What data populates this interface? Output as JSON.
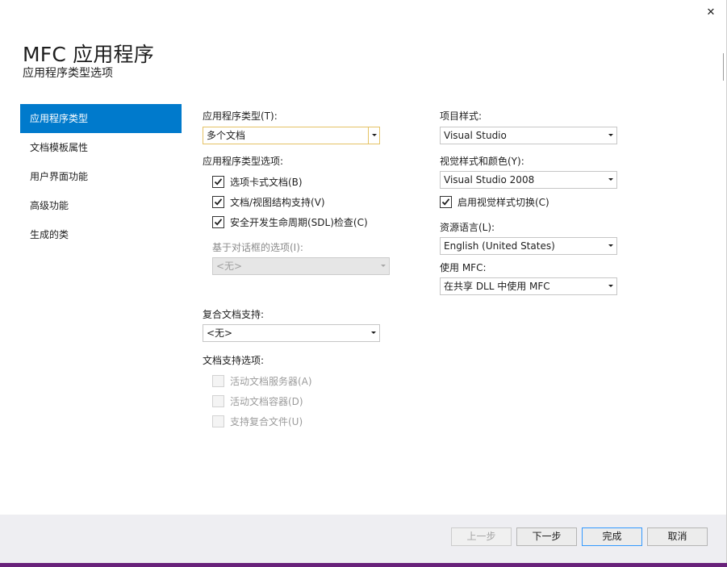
{
  "window": {
    "close_glyph": "✕"
  },
  "header": {
    "title": "MFC 应用程序",
    "subtitle": "应用程序类型选项"
  },
  "sidebar": {
    "items": [
      {
        "label": "应用程序类型",
        "active": true
      },
      {
        "label": "文档模板属性",
        "active": false
      },
      {
        "label": "用户界面功能",
        "active": false
      },
      {
        "label": "高级功能",
        "active": false
      },
      {
        "label": "生成的类",
        "active": false
      }
    ]
  },
  "left": {
    "app_type": {
      "label": "应用程序类型(T):",
      "value": "多个文档"
    },
    "app_type_options": {
      "label": "应用程序类型选项:",
      "checks": [
        {
          "label": "选项卡式文档(B)",
          "checked": true
        },
        {
          "label": "文档/视图结构支持(V)",
          "checked": true
        },
        {
          "label": "安全开发生命周期(SDL)检查(C)",
          "checked": true
        }
      ]
    },
    "dialog_options": {
      "label": "基于对话框的选项(I):",
      "value": "<无>"
    },
    "compound_doc": {
      "label": "复合文档支持:",
      "value": "<无>"
    },
    "doc_support": {
      "label": "文档支持选项:",
      "checks": [
        {
          "label": "活动文档服务器(A)",
          "checked": false
        },
        {
          "label": "活动文档容器(D)",
          "checked": false
        },
        {
          "label": "支持复合文件(U)",
          "checked": false
        }
      ]
    }
  },
  "right": {
    "project_style": {
      "label": "项目样式:",
      "value": "Visual Studio"
    },
    "visual_style": {
      "label": "视觉样式和颜色(Y):",
      "value": "Visual Studio 2008"
    },
    "enable_switch": {
      "label": "启用视觉样式切换(C)",
      "checked": true
    },
    "resource_lang": {
      "label": "资源语言(L):",
      "value": "English (United States)"
    },
    "use_mfc": {
      "label": "使用 MFC:",
      "value": "在共享 DLL 中使用 MFC"
    }
  },
  "footer": {
    "prev_label": "上一步",
    "next_label": "下一步",
    "finish_label": "完成",
    "cancel_label": "取消"
  },
  "colors": {
    "accent": "#007acc",
    "footer_bg": "#eeeef2",
    "bottom_strip": "#68217a",
    "focus_border": "#e5c365"
  }
}
